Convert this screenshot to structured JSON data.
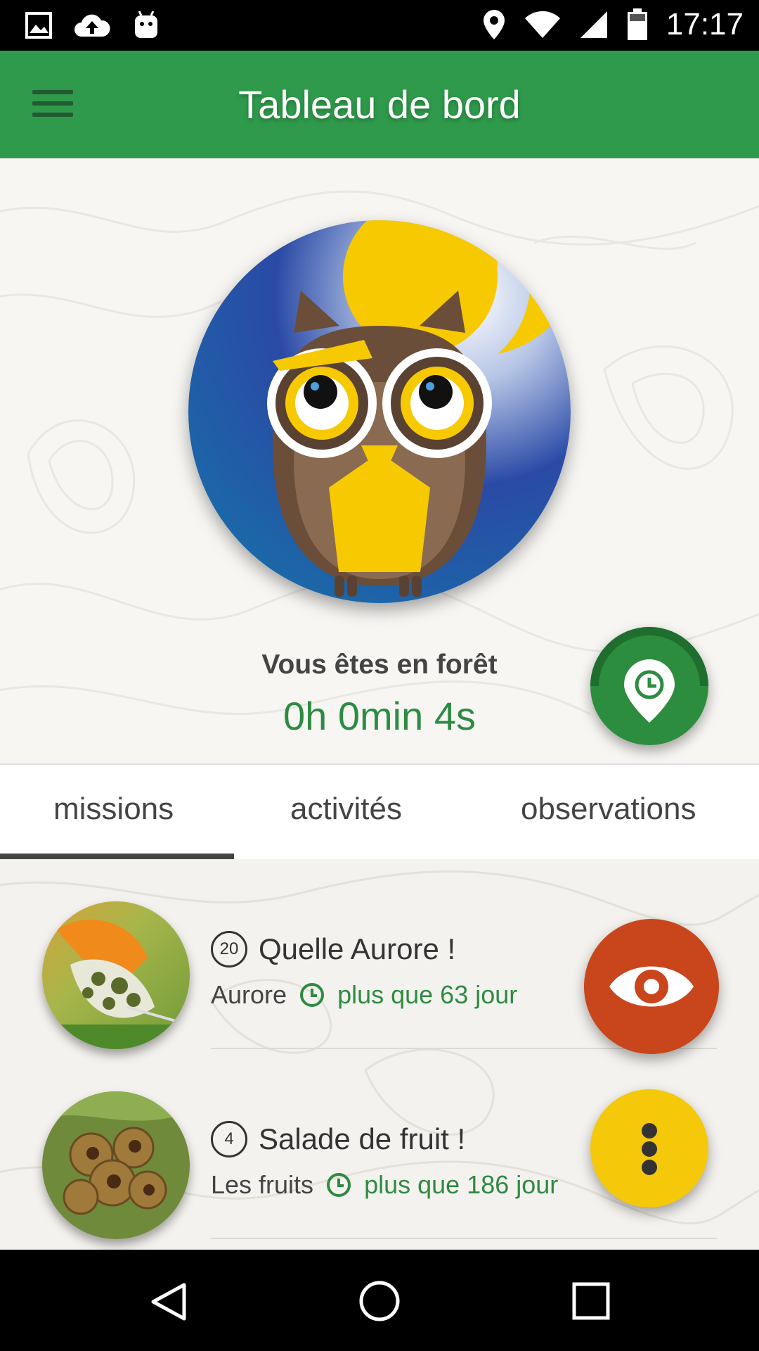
{
  "status_bar": {
    "time": "17:17",
    "icons": [
      "image-icon",
      "cloud-upload-icon",
      "android-icon",
      "location-icon",
      "wifi-icon",
      "signal-icon",
      "battery-icon"
    ]
  },
  "app_bar": {
    "title": "Tableau de bord",
    "menu_icon": "hamburger-menu-icon",
    "color": "#2f9a4b"
  },
  "hero": {
    "status_label": "Vous êtes en forêt",
    "timer": "0h 0min 4s",
    "fab_icon": "location-clock-icon",
    "accent": "#2e8b43"
  },
  "tabs": [
    {
      "label": "missions",
      "selected": true
    },
    {
      "label": "activités",
      "selected": false
    },
    {
      "label": "observations",
      "selected": false
    }
  ],
  "missions": [
    {
      "count": "20",
      "title": "Quelle Aurore !",
      "category": "Aurore",
      "duration": "plus que 63 jour"
    },
    {
      "count": "4",
      "title": "Salade de fruit !",
      "category": "Les fruits",
      "duration": "plus que 186 jour"
    }
  ],
  "fabs": {
    "observe_icon": "eye-icon",
    "observe_color": "#c9451c",
    "more_icon": "more-vert-icon",
    "more_color": "#f5c90a"
  },
  "nav_bar": {
    "icons": [
      "back-icon",
      "home-icon",
      "recents-icon"
    ]
  }
}
